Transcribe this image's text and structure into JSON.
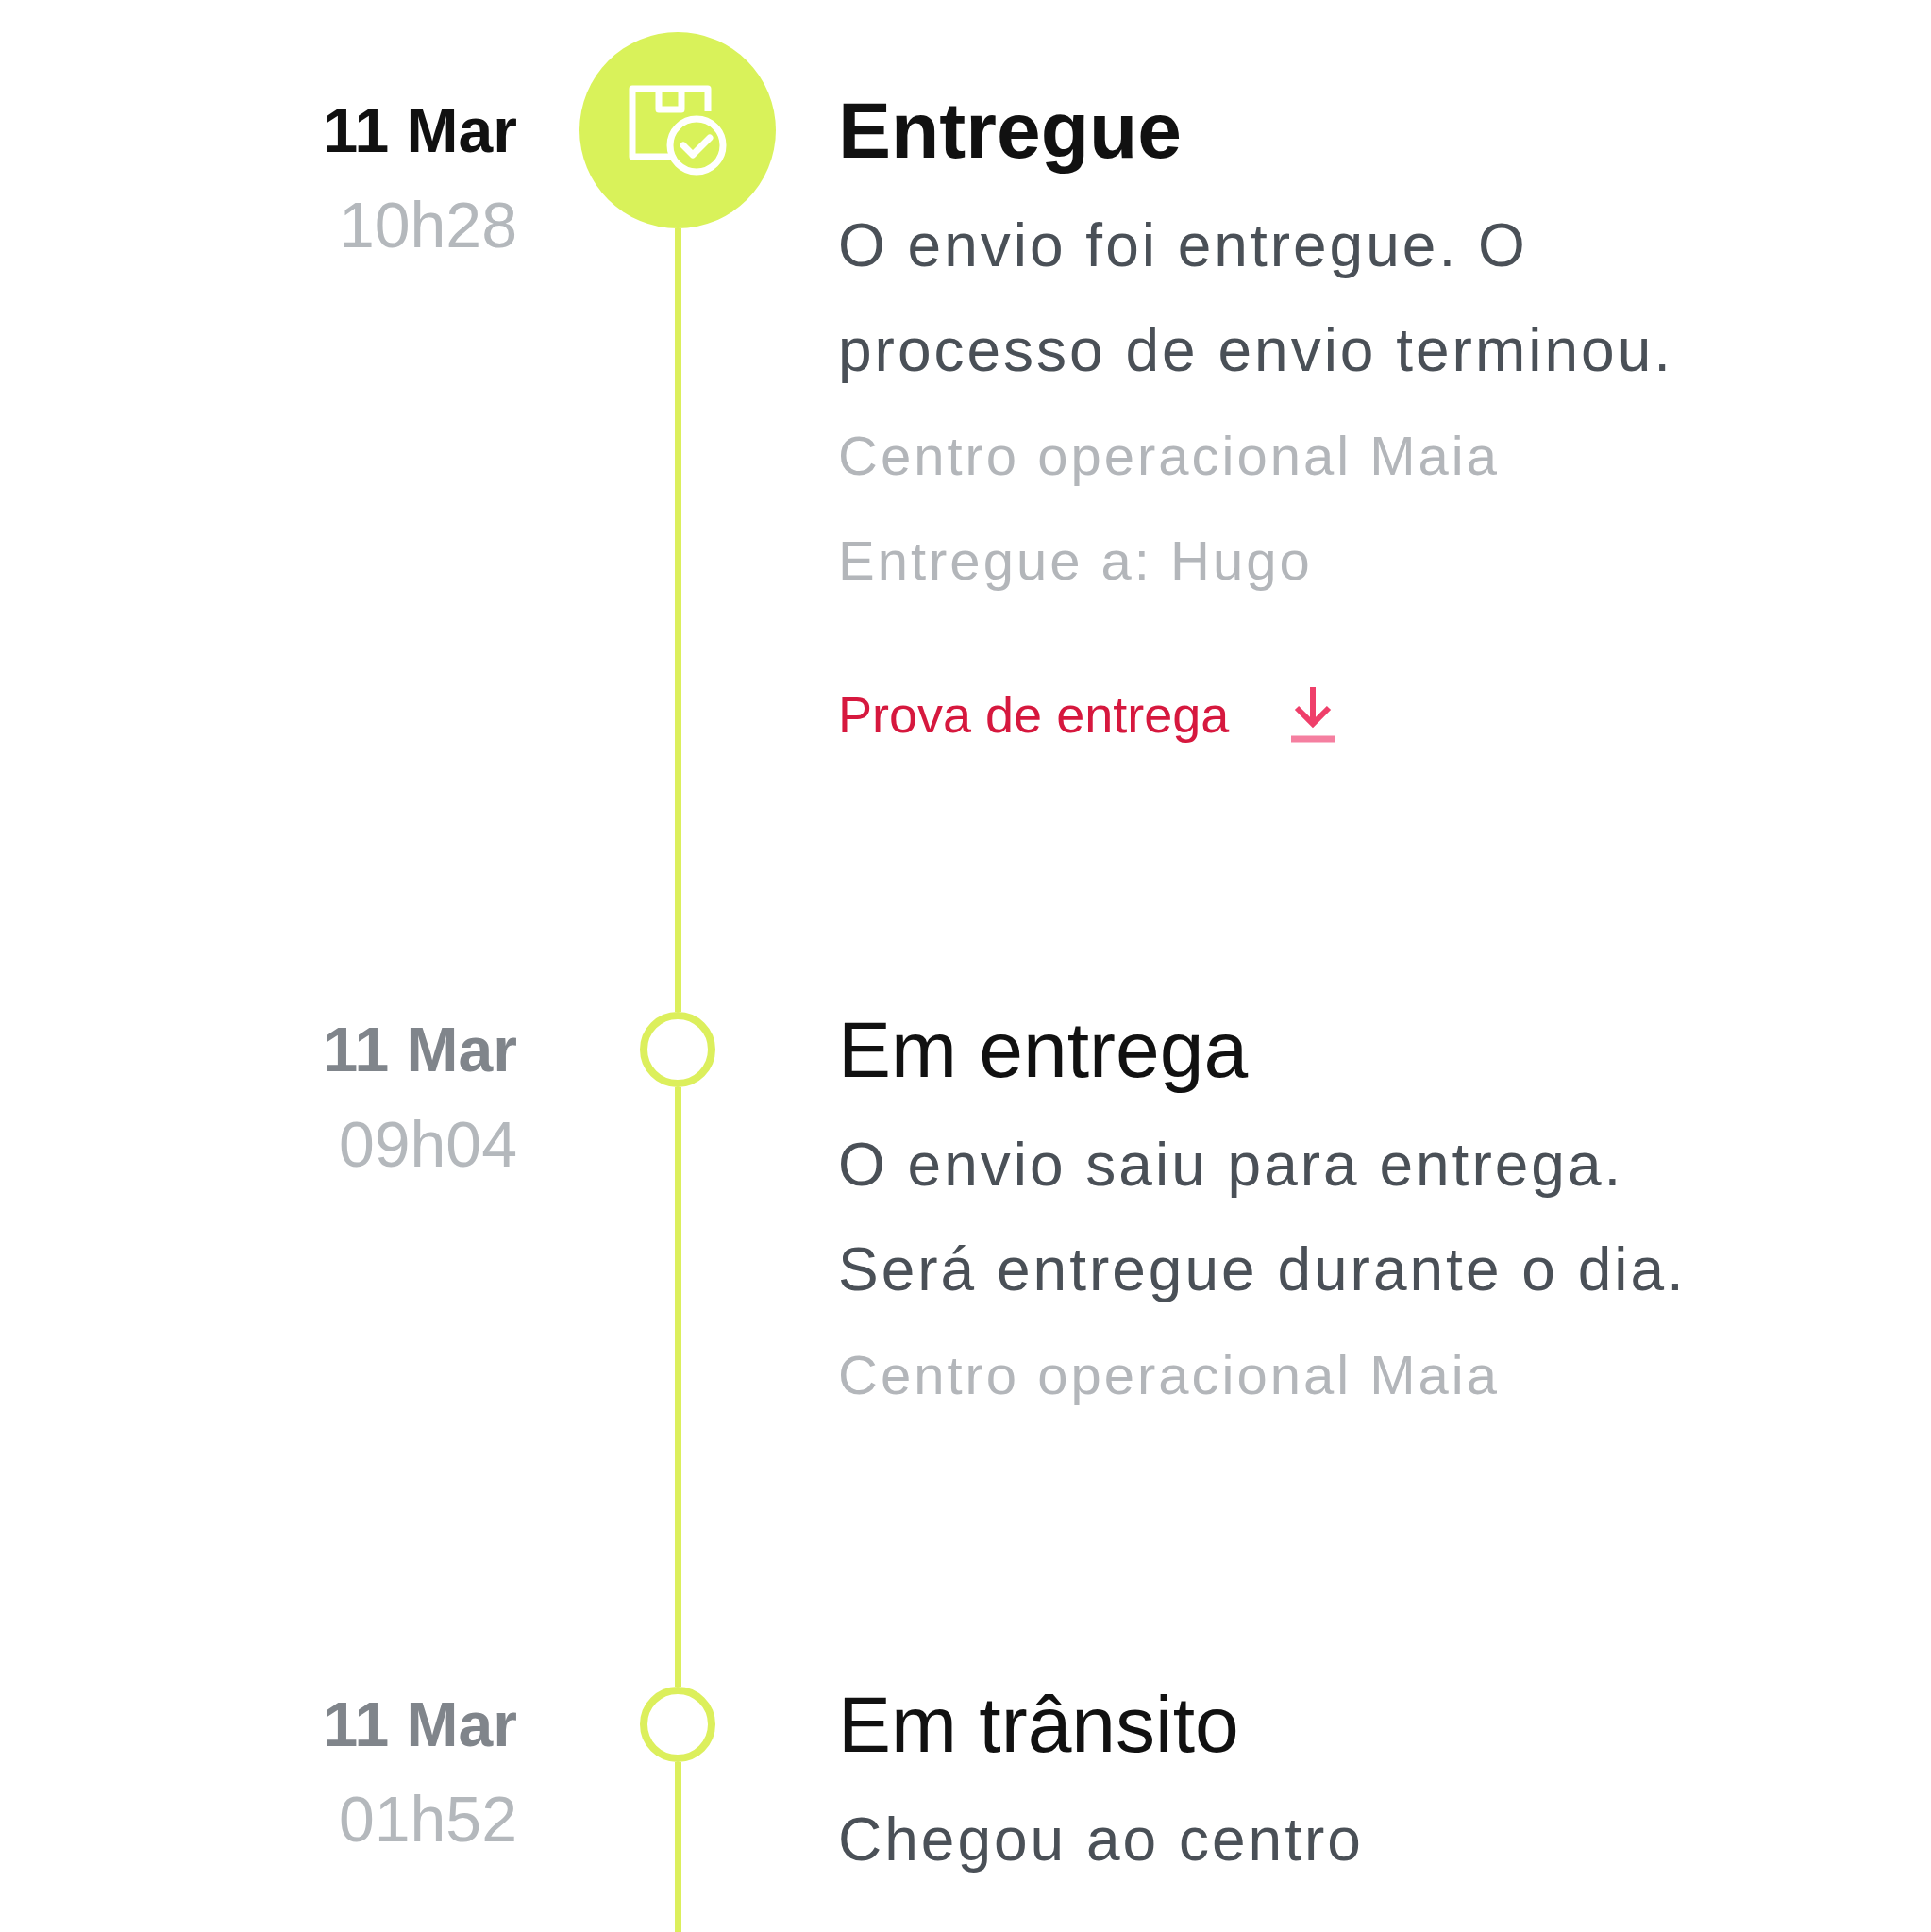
{
  "events": [
    {
      "date": "11 Mar",
      "time": "10h28",
      "title": "Entregue",
      "active": true,
      "description": "O envio foi entregue. O processo de envio terminou.",
      "details": [
        "Centro operacional Maia",
        "Entregue a: Hugo"
      ],
      "link": {
        "label": "Prova de entrega"
      }
    },
    {
      "date": "11 Mar",
      "time": "09h04",
      "title": "Em entrega",
      "active": false,
      "description": "O envio saiu para entrega. Será entregue durante o dia.",
      "details": [
        "Centro operacional Maia"
      ]
    },
    {
      "date": "11 Mar",
      "time": "01h52",
      "title": "Em trânsito",
      "active": false,
      "description": "Chegou ao centro"
    }
  ]
}
